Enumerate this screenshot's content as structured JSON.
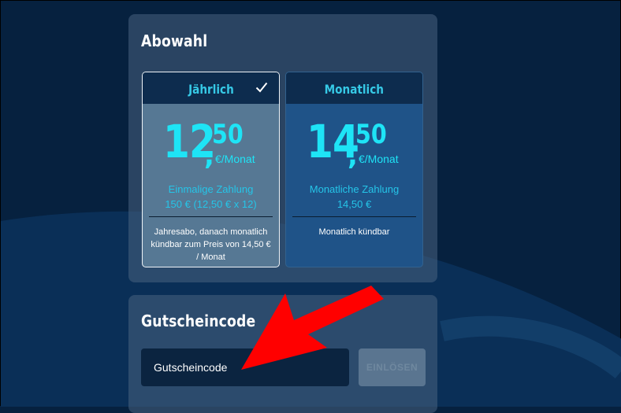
{
  "abo_section": {
    "title": "Abowahl",
    "plans": [
      {
        "name": "Jährlich",
        "selected": true,
        "price_main": "12",
        "price_comma": ",",
        "price_cents": "50",
        "price_unit": "€/Monat",
        "payment_type": "Einmalige Zahlung",
        "payment_amount": "150 € (12,50 € x 12)",
        "note": "Jahresabo, danach monatlich kündbar zum Preis von 14,50 € / Monat"
      },
      {
        "name": "Monatlich",
        "selected": false,
        "price_main": "14",
        "price_comma": ",",
        "price_cents": "50",
        "price_unit": "€/Monat",
        "payment_type": "Monatliche Zahlung",
        "payment_amount": "14,50 €",
        "note": "Monatlich kündbar"
      }
    ]
  },
  "voucher_section": {
    "title": "Gutscheincode",
    "input_placeholder": "Gutscheincode",
    "input_value": "",
    "redeem_label": "EINLÖSEN"
  },
  "icons": {
    "selected_check": "checkmark-icon",
    "annotation": "red-arrow-icon"
  },
  "colors": {
    "background": "#06213f",
    "accent_cyan": "#1ee4f6",
    "selected_card": "#567894",
    "unselected_card": "#1f5388",
    "annotation_red": "#ff0000"
  }
}
